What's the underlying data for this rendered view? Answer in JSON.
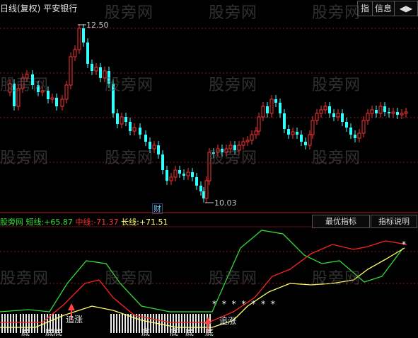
{
  "header": {
    "title": "日线(复权)",
    "stock_name": "平安银行",
    "buttons": [
      "指",
      "信息",
      "◀▶"
    ]
  },
  "main_chart": {
    "high_label": "12.50",
    "low_label": "10.03",
    "cai_marker": "财"
  },
  "indicator": {
    "name": "股旁网",
    "short_label": "短线:",
    "short_value": "+65.87",
    "mid_label": "中线:",
    "mid_value": "-71.37",
    "long_label": "长线:",
    "long_value": "+71.51",
    "btn_best": "最优指标",
    "btn_help": "指标说明",
    "signals": {
      "zhui_zhang_1": "追涨",
      "zhui_zhang_2": "追涨",
      "di_labels": [
        "底",
        "底底",
        "底",
        "底",
        "底",
        "底"
      ]
    }
  },
  "watermark": "股旁网",
  "colors": {
    "up": "#ff3333",
    "down": "#33ffff",
    "short": "#33dd33",
    "mid": "#ff2222",
    "long": "#ffff66",
    "grid": "#8a1a1a",
    "divider": "#b02020"
  }
}
